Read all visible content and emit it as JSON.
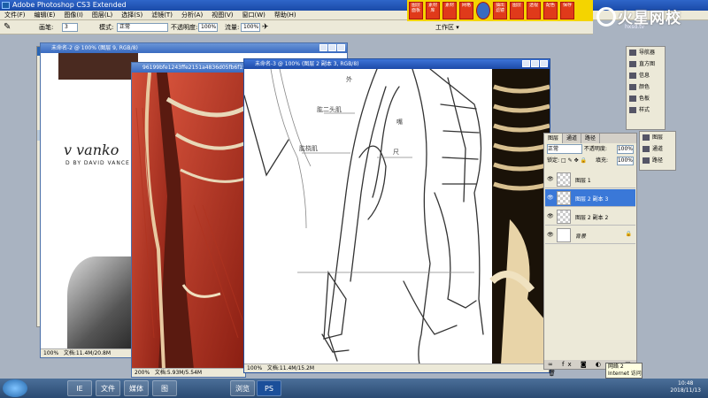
{
  "app": {
    "title": "Adobe Photoshop CS3 Extended"
  },
  "menu": [
    "文件(F)",
    "编辑(E)",
    "图像(I)",
    "图层(L)",
    "选择(S)",
    "滤镜(T)",
    "分析(A)",
    "视图(V)",
    "窗口(W)",
    "帮助(H)"
  ],
  "options": {
    "brush_label": "画笔:",
    "brush_size": "3",
    "mode_label": "模式:",
    "mode_value": "正常",
    "opacity_label": "不透明度:",
    "opacity_value": "100%",
    "flow_label": "流量:",
    "flow_value": "100%",
    "workspace": "工作区 ▾"
  },
  "promo_buttons": [
    "图层面板",
    "素材库",
    "素材",
    "网格",
    "",
    "抽出滤镜",
    "图层",
    "透视",
    "配色",
    "保存"
  ],
  "logo": {
    "text": "火星网校",
    "sub": "hxsd.tv"
  },
  "windows": {
    "win1": {
      "title": "未命名-2 @ 100% (图层 9, RGB/8)",
      "status": "文档:11.4M/20.8M",
      "zoom": "100%",
      "art_text1": "v vanko",
      "art_text2": "D BY DAVID VANCE"
    },
    "win2": {
      "title": "96199bfe1243ffe2151a4836d05fb6f15",
      "status": "文档:5.93M/5.54M",
      "zoom": "200%"
    },
    "win3": {
      "title": "未命名-3 @ 100% (图层 2 副本 3, RGB/8)",
      "status": "文档:11.4M/15.2M",
      "zoom": "100%"
    }
  },
  "sketch_labels": [
    "外",
    "肱二头肌",
    "肱桡肌",
    "尺",
    "嘴"
  ],
  "layers_panel": {
    "tabs": [
      "图层",
      "通道",
      "路径"
    ],
    "blend_mode": "正常",
    "opacity_label": "不透明度:",
    "opacity_value": "100%",
    "lock_label": "锁定:",
    "fill_label": "填充:",
    "fill_value": "100%",
    "layers": [
      {
        "name": "图层 1",
        "selected": false
      },
      {
        "name": "图层 2 副本 3",
        "selected": true
      },
      {
        "name": "图层 2 副本 2",
        "selected": false
      },
      {
        "name": "背景",
        "selected": false
      }
    ]
  },
  "nav_panel": [
    "导航器",
    "直方图",
    "信息",
    "颜色",
    "色板",
    "样式"
  ],
  "right_panel": [
    "图层",
    "通道",
    "路径"
  ],
  "tooltip": {
    "line1": "网络 2",
    "line2": "Internet 访问"
  },
  "clock": {
    "time": "10:48",
    "date": "2018/11/13"
  },
  "taskbar_apps": [
    "IE",
    "文件",
    "媒体",
    "图",
    "浏览",
    "PS"
  ]
}
